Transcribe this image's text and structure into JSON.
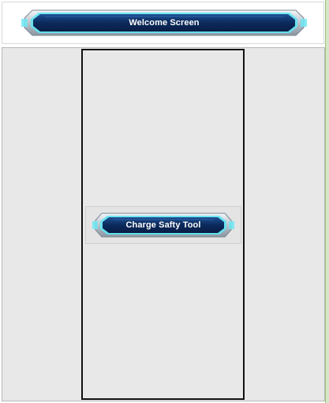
{
  "header": {
    "title_button_label": "Welcome Screen"
  },
  "main": {
    "action_button_label": "Charge Safty Tool"
  },
  "colors": {
    "button_fill": "#0f2e63",
    "button_glow": "#5fe6f2",
    "panel_bg": "#e8e8e8",
    "border": "#111111"
  }
}
